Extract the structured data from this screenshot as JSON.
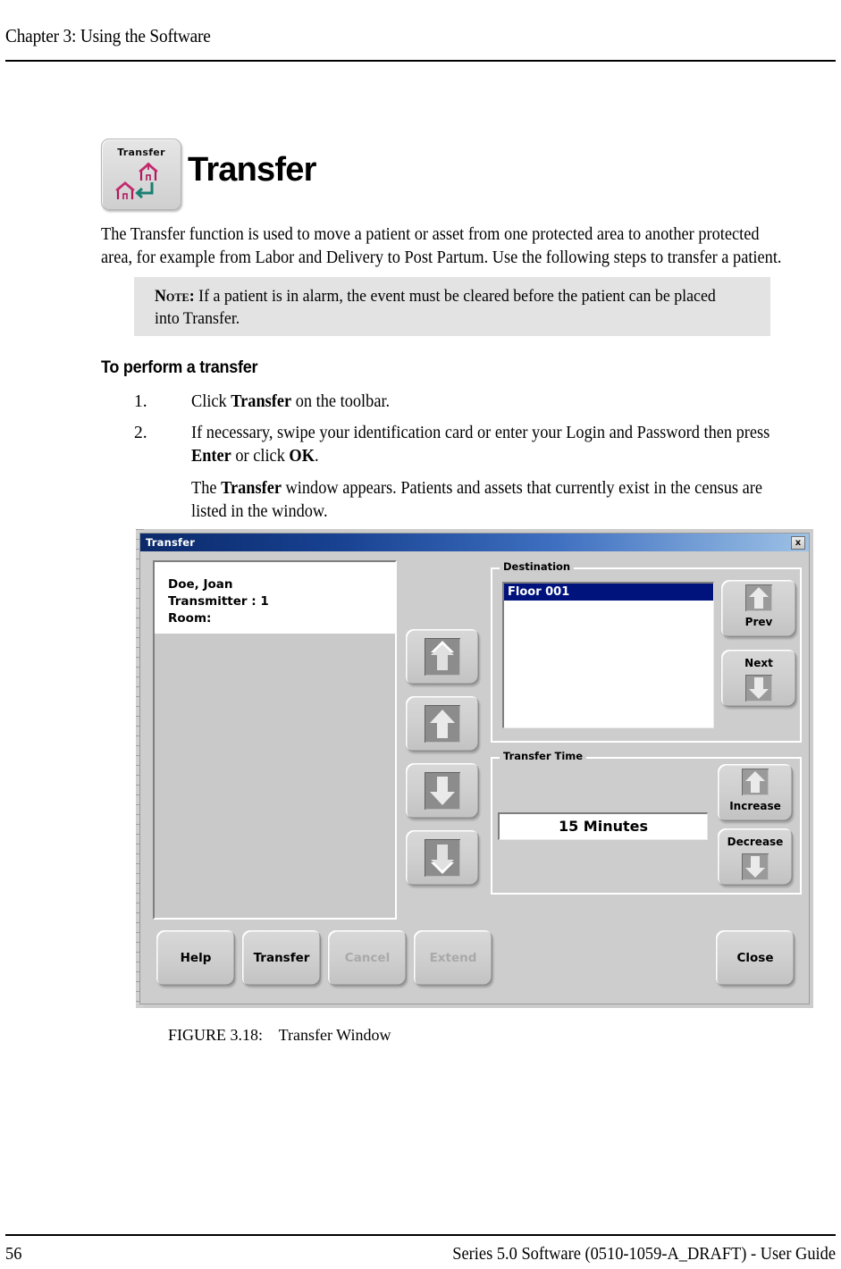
{
  "header": {
    "chapter": "Chapter 3: Using the Software"
  },
  "title_block": {
    "icon_label": "Transfer",
    "icon_name": "transfer-toolbar-icon",
    "heading": "Transfer"
  },
  "intro": {
    "paragraph": "The Transfer function is used to move a patient or asset from one protected area to another protected area, for example from Labor and Delivery to Post Partum. Use the following steps to transfer a patient."
  },
  "note": {
    "label": "Note:",
    "text": " If a patient is in alarm, the event must be cleared before the patient can be placed into Transfer."
  },
  "procedure": {
    "heading": "To perform a transfer",
    "steps": [
      {
        "number": "1.",
        "pre": "Click ",
        "bold": "Transfer",
        "post": " on the toolbar."
      },
      {
        "number": "2.",
        "pre": "If necessary, swipe your identification card or enter your Login and Password then press ",
        "bold": "Enter",
        "mid": " or click ",
        "bold2": "OK",
        "post": "."
      }
    ],
    "result_pre": "The ",
    "result_bold": "Transfer",
    "result_post": " window appears. Patients and assets that currently exist in the census are listed in the window."
  },
  "screenshot": {
    "window_title": "Transfer",
    "close_glyph": "x",
    "census": {
      "entry": {
        "name": "Doe, Joan",
        "transmitter": "Transmitter : 1",
        "room": "Room:"
      }
    },
    "move_buttons": [
      {
        "name": "page-up-button",
        "icon": "double-chevron-up-icon"
      },
      {
        "name": "scroll-up-button",
        "icon": "arrow-up-icon"
      },
      {
        "name": "scroll-down-button",
        "icon": "arrow-down-icon"
      },
      {
        "name": "page-down-button",
        "icon": "double-chevron-down-icon"
      }
    ],
    "destination": {
      "group_label": "Destination",
      "items": [
        {
          "label": "Floor 001",
          "selected": true
        }
      ],
      "prev_label": "Prev",
      "next_label": "Next"
    },
    "transfer_time": {
      "group_label": "Transfer Time",
      "value": "15 Minutes",
      "increase_label": "Increase",
      "decrease_label": "Decrease"
    },
    "actions": [
      {
        "label": "Help",
        "enabled": true
      },
      {
        "label": "Transfer",
        "enabled": true
      },
      {
        "label": "Cancel",
        "enabled": false
      },
      {
        "label": "Extend",
        "enabled": false
      },
      {
        "label": "Close",
        "enabled": true
      }
    ],
    "colors": {
      "titlebar_start": "#0b2a6b",
      "titlebar_end": "#9dc2e6",
      "selection": "#00127c",
      "dialog_face": "#cdcdcd"
    }
  },
  "figure": {
    "caption": "FIGURE 3.18:    Transfer Window"
  },
  "footer": {
    "page_number": "56",
    "doc_line": "Series 5.0 Software (0510-1059-A_DRAFT) - User Guide"
  }
}
